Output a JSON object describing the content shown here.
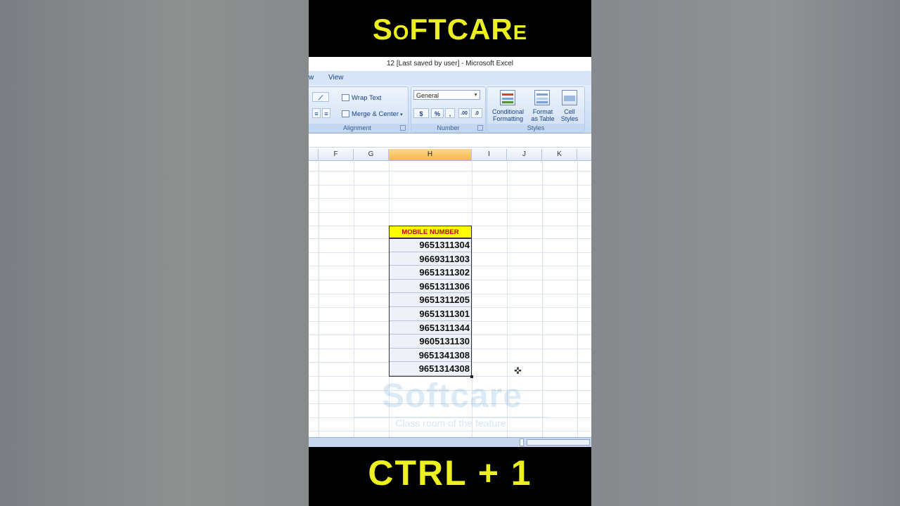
{
  "video": {
    "brand": "SoFTCARe",
    "shortcut": "CTRL + 1"
  },
  "excel": {
    "window_title": "12 [Last saved by user] - Microsoft Excel",
    "tabs": [
      "w",
      "View"
    ],
    "ribbon": {
      "alignment": {
        "wrap_text": "Wrap Text",
        "merge_center": "Merge & Center",
        "group_label": "Alignment"
      },
      "number": {
        "format_value": "General",
        "currency": "$",
        "percent": "%",
        "comma": ",",
        "inc_decimal": ".00",
        "dec_decimal": ".0",
        "group_label": "Number"
      },
      "styles": {
        "conditional_line1": "Conditional",
        "conditional_line2": "Formatting",
        "format_line1": "Format",
        "format_line2": "as Table",
        "cell_line1": "Cell",
        "cell_line2": "Styles",
        "group_label": "Styles"
      }
    },
    "columns": [
      "F",
      "G",
      "H",
      "I",
      "J",
      "K"
    ],
    "selected_column": "H",
    "header_cell": "MOBILE NUMBER",
    "numbers": [
      "9651311304",
      "9669311303",
      "9651311302",
      "9651311306",
      "9651311205",
      "9651311301",
      "9651311344",
      "9605131130",
      "9651341308",
      "9651314308"
    ],
    "watermark": "Softcare",
    "tagline": "Class room of the feature"
  },
  "colors": {
    "brand_yellow": "#ecf021",
    "header_fill": "#ffff00",
    "header_text": "#c00000",
    "selected_column": "#f4b84d"
  }
}
